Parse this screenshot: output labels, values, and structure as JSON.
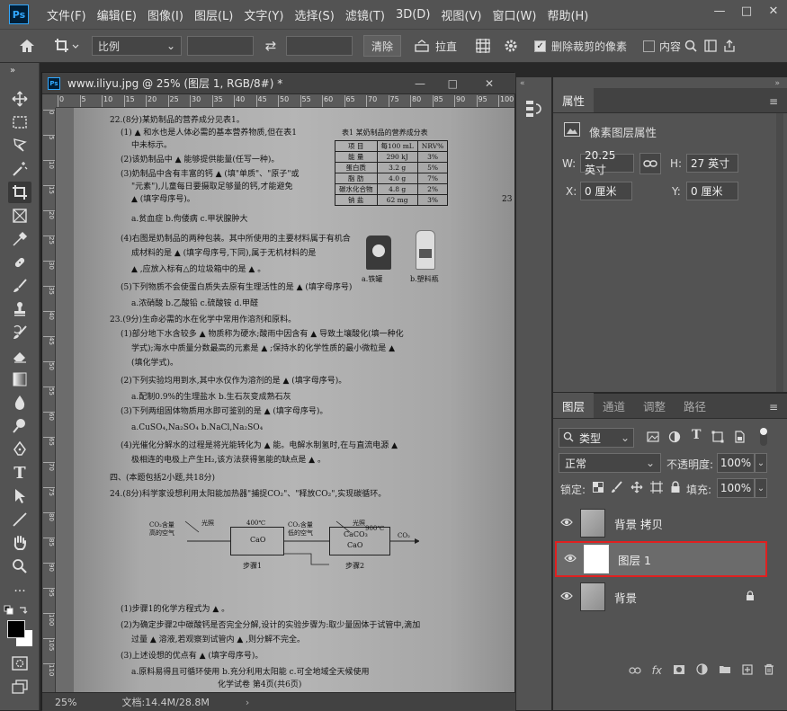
{
  "menubar": {
    "logo": "Ps",
    "items": [
      "文件(F)",
      "编辑(E)",
      "图像(I)",
      "图层(L)",
      "文字(Y)",
      "选择(S)",
      "滤镜(T)",
      "3D(D)",
      "视图(V)",
      "窗口(W)",
      "帮助(H)"
    ],
    "window_buttons": [
      "—",
      "□",
      "✕"
    ]
  },
  "options": {
    "ratio": "比例",
    "ratio_arrow": "⌄",
    "swap_icon": "⇄",
    "clear": "清除",
    "straighten": "拉直",
    "delete_cropped": "删除裁剪的像素",
    "content_aware": "内容"
  },
  "document": {
    "title": "www.iliyu.jpg @ 25% (图层 1, RGB/8#) *",
    "zoom": "25%",
    "doc_info": "文档:14.4M/28.8M",
    "ruler_h": [
      "0",
      "5",
      "10",
      "15",
      "20",
      "25",
      "30",
      "35",
      "40",
      "45",
      "50",
      "55",
      "60",
      "65",
      "70",
      "75",
      "80",
      "85",
      "90",
      "95",
      "100"
    ],
    "ruler_v": [
      "0",
      "5",
      "10",
      "15",
      "20",
      "25",
      "30",
      "35",
      "40",
      "45",
      "50",
      "55",
      "60",
      "65",
      "70",
      "75",
      "80",
      "85",
      "90",
      "95",
      "100",
      "105",
      "110"
    ]
  },
  "paper": {
    "lines": [
      "22.(8分)某奶制品的营养成分见表1。",
      "(1) ▲ 和水也是人体必需的基本营养物质,但在表1",
      "中未标示。",
      "(2)该奶制品中 ▲ 能够提供能量(任写一种)。",
      "(3)奶制品中含有丰富的钙 ▲ (填\"单质\"、\"原子\"或",
      "\"元素\"),儿童每日要摄取足够量的钙,才能避免",
      "▲ (填字母序号)。",
      "a.贫血症   b.佝偻病   c.甲状腺肿大",
      "(4)右图是奶制品的两种包装。其中所使用的主要材料属于有机合",
      "成材料的是 ▲ (填字母序号,下同),属于无机材料的是",
      "▲ ,应放入标有△的垃圾箱中的是 ▲ 。",
      "(5)下列物质不会使蛋白质失去原有生理活性的是 ▲ (填字母序号)",
      "a.浓硝酸   b.乙酸铅   c.硫酸铵   d.甲醛",
      "23.(9分)生命必需的水在化学中常用作溶剂和原料。",
      "(1)部分地下水含较多 ▲ 物质称为硬水;酸雨中因含有 ▲ 导致土壤酸化(填一种化",
      "学式);海水中质量分数最高的元素是 ▲ ;保持水的化学性质的最小微粒是 ▲",
      "(填化学式)。",
      "(2)下列实验均用到水,其中水仅作为溶剂的是 ▲ (填字母序号)。",
      "a.配制0.9%的生理盐水          b.生石灰变成熟石灰",
      "(3)下列两组固体物质用水即可鉴别的是 ▲ (填字母序号)。",
      "a.CuSO₄,Na₂SO₄               b.NaCl,Na₂SO₄",
      "(4)光催化分解水的过程是将光能转化为 ▲ 能。电解水制氢时,在与直流电源 ▲",
      "极相连的电极上产生H₂,该方法获得氢能的缺点是 ▲ 。",
      "四、(本题包括2小题,共18分)",
      "24.(8分)科学家设想利用太阳能加热器\"捕捉CO₂\"、\"释放CO₂\",实现碳循环。",
      "(1)步骤1的化学方程式为 ▲ 。",
      "(2)为确定步骤2中碳酸钙是否完全分解,设计的实验步骤为:取少量固体于试管中,滴加",
      "过量 ▲ 溶液,若观察到试管内 ▲ ,则分解不完全。",
      "(3)上述设想的优点有 ▲ (填字母序号)。",
      "a.原料易得且可循环使用   b.充分利用太阳能   c.可全地域全天候使用",
      "化学试卷  第4页(共6页)"
    ],
    "table": {
      "caption": "表1 某奶制品的营养成分表",
      "header": [
        "项 目",
        "每100 mL",
        "NRV%"
      ],
      "rows": [
        [
          "能 量",
          "290 kJ",
          "3%"
        ],
        [
          "蛋白质",
          "3.2 g",
          "5%"
        ],
        [
          "脂 肪",
          "4.0 g",
          "7%"
        ],
        [
          "碳水化合物",
          "4.8 g",
          "2%"
        ],
        [
          "钠 盐",
          "62 mg",
          "3%"
        ]
      ]
    },
    "pkg_labels": [
      "a.铁罐",
      "b.塑料瓶"
    ],
    "diagram": {
      "light1": "光照",
      "temp1": "400℃",
      "in_left": "CO₂含量\n高的空气",
      "box1": "CaO",
      "out_mid": "CO₂含量\n低的空气",
      "step1": "步骤1",
      "light2": "光照",
      "temp2": "900℃",
      "box2a": "CaCO₃",
      "box2b": "CaO",
      "out_right": "CO₂",
      "step2": "步骤2"
    },
    "side_number": "23"
  },
  "properties": {
    "tab": "属性",
    "kind": "像素图层属性",
    "w_label": "W:",
    "w_value": "20.25 英寸",
    "h_label": "H:",
    "h_value": "27 英寸",
    "x_label": "X:",
    "x_value": "0 厘米",
    "y_label": "Y:",
    "y_value": "0 厘米"
  },
  "layers_panel": {
    "tabs": [
      "图层",
      "通道",
      "调整",
      "路径"
    ],
    "filter": "类型",
    "blend_mode": "正常",
    "opacity_label": "不透明度:",
    "opacity": "100%",
    "lock_label": "锁定:",
    "fill_label": "填充:",
    "fill": "100%",
    "layers": [
      {
        "name": "背景 拷贝"
      },
      {
        "name": "图层 1"
      },
      {
        "name": "背景"
      }
    ],
    "fx": "fx"
  },
  "colors": {
    "highlight": "#e02020",
    "accent": "#31a8ff"
  }
}
